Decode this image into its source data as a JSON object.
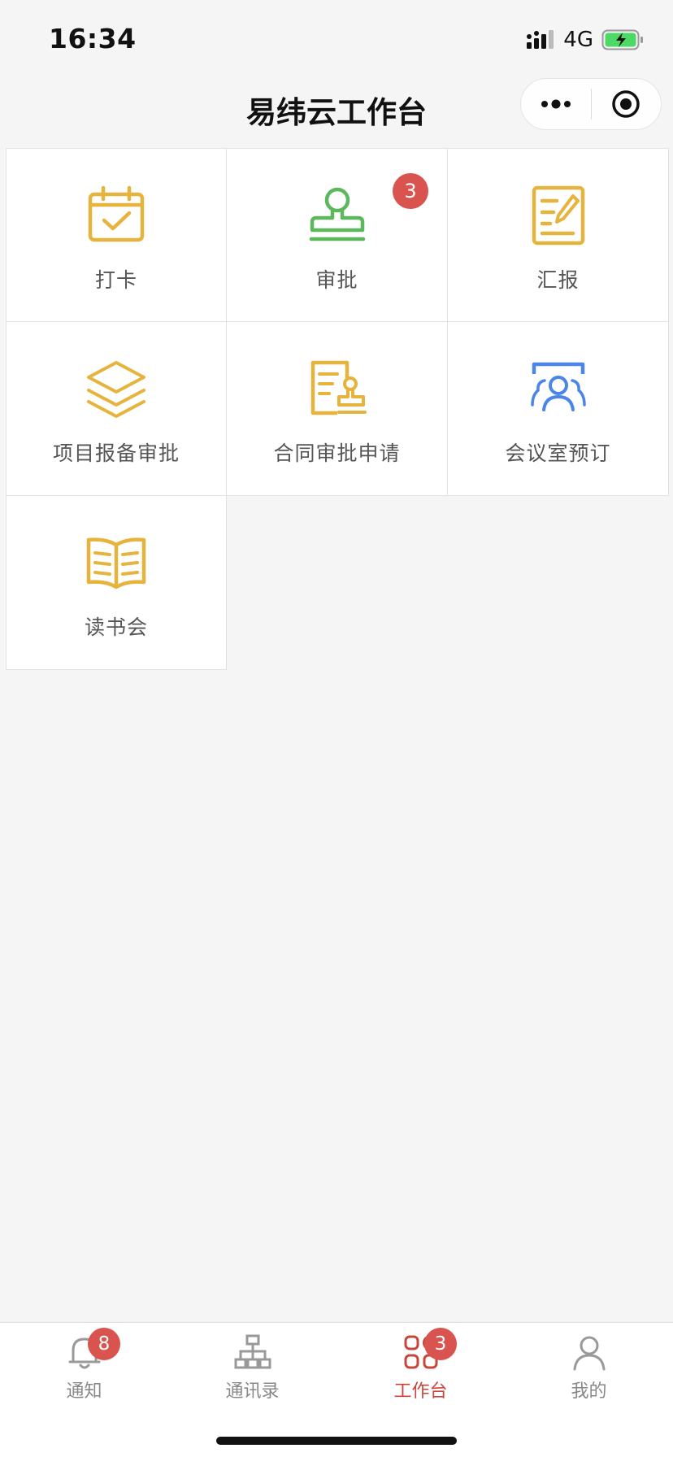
{
  "status_bar": {
    "time": "16:34",
    "network": "4G"
  },
  "nav": {
    "title": "易纬云工作台"
  },
  "colors": {
    "icon_yellow": "#e6b43c",
    "icon_green": "#5cb85c",
    "icon_blue": "#4a86e8",
    "badge_red": "#d9534f",
    "tab_active": "#c9453c"
  },
  "apps": [
    {
      "label": "打卡",
      "icon": "calendar-check-icon"
    },
    {
      "label": "审批",
      "icon": "stamp-icon",
      "badge": "3"
    },
    {
      "label": "汇报",
      "icon": "report-edit-icon"
    },
    {
      "label": "项目报备审批",
      "icon": "layers-icon"
    },
    {
      "label": "合同审批申请",
      "icon": "contract-stamp-icon"
    },
    {
      "label": "会议室预订",
      "icon": "meeting-room-icon"
    },
    {
      "label": "读书会",
      "icon": "open-book-icon"
    }
  ],
  "tabs": [
    {
      "label": "通知",
      "icon": "bell-icon",
      "badge": "8"
    },
    {
      "label": "通讯录",
      "icon": "org-chart-icon"
    },
    {
      "label": "工作台",
      "icon": "apps-grid-icon",
      "badge": "3",
      "active": true
    },
    {
      "label": "我的",
      "icon": "user-icon"
    }
  ]
}
